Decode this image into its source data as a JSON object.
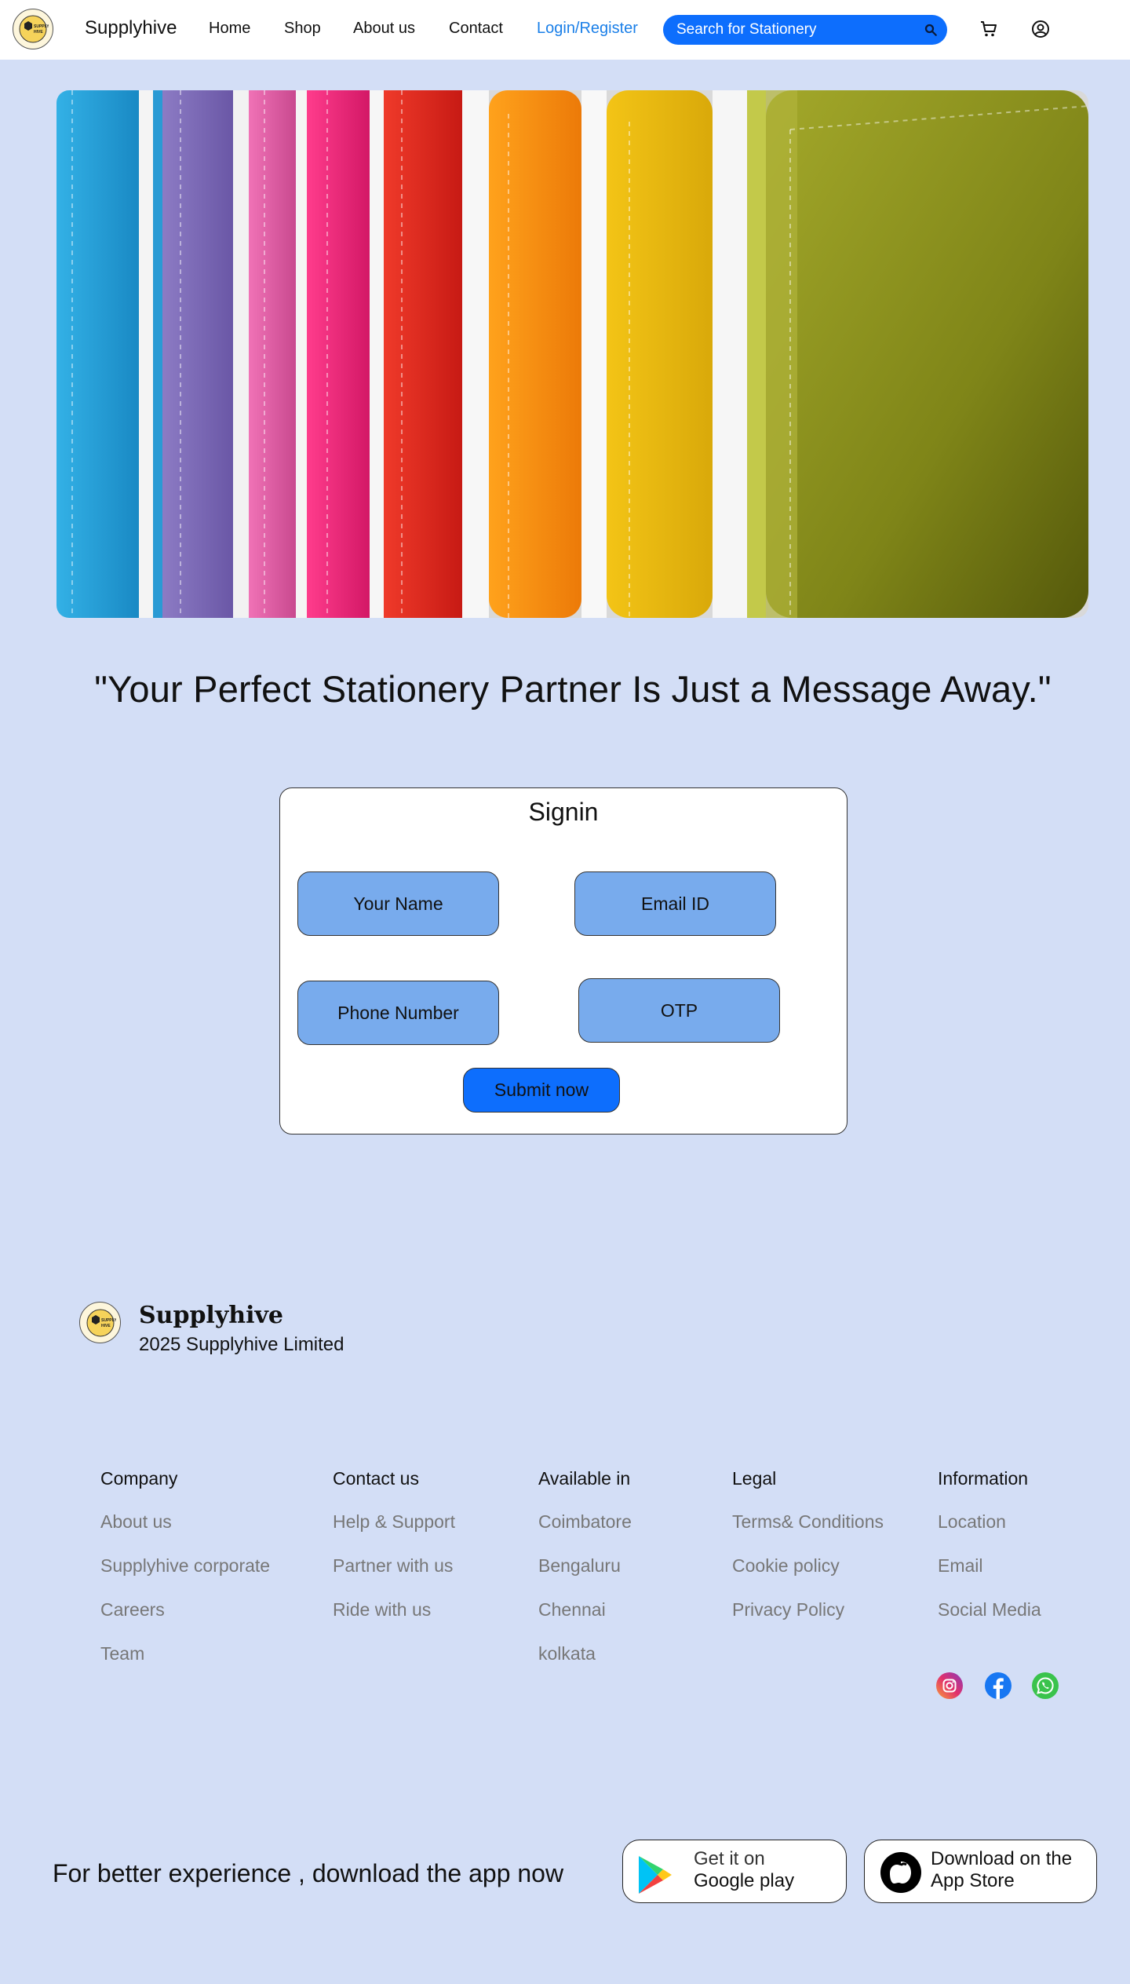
{
  "navbar": {
    "brand": "Supplyhive",
    "logo_text": "SUPPLY HIVE",
    "links": [
      "Home",
      "Shop",
      "About us",
      "Contact"
    ],
    "login_label": "Login/Register",
    "search_placeholder": "Search for Stationery",
    "icons": [
      "search-icon",
      "cart-icon",
      "account-icon"
    ]
  },
  "hero": {
    "image": "colorful-notebooks"
  },
  "headline": "\"Your Perfect Stationery Partner Is Just a Message Away.\"",
  "signin": {
    "title": "Signin",
    "fields": {
      "name": "Your Name",
      "email": "Email ID",
      "phone": "Phone Number",
      "otp": "OTP"
    },
    "submit_label": "Submit now"
  },
  "footer": {
    "brand": "Supplyhive",
    "copyright": "2025 Supplyhive Limited",
    "columns": {
      "company": {
        "heading": "Company",
        "links": [
          "About us",
          "Supplyhive corporate",
          "Careers",
          "Team"
        ]
      },
      "contact": {
        "heading": "Contact us",
        "links": [
          "Help & Support",
          "Partner with us",
          "Ride with us"
        ]
      },
      "available": {
        "heading": "Available in",
        "links": [
          "Coimbatore",
          "Bengaluru",
          "Chennai",
          "kolkata"
        ]
      },
      "legal": {
        "heading": "Legal",
        "links": [
          "Terms& Conditions",
          "Cookie policy",
          "Privacy Policy"
        ]
      },
      "information": {
        "heading": "Information",
        "links": [
          "Location",
          "Email",
          "Social Media"
        ]
      }
    },
    "social_icons": [
      "instagram-icon",
      "facebook-icon",
      "whatsapp-icon"
    ]
  },
  "app_download": {
    "text": "For better experience , download the app now",
    "google_line1": "Get it on",
    "google_line2": "Google play",
    "apple_line1": "Download on the",
    "apple_line2": "App Store"
  },
  "colors": {
    "page_bg": "#d3def6",
    "accent": "#0d6efd",
    "field_bg": "#78abed",
    "link_gray": "#777777"
  }
}
